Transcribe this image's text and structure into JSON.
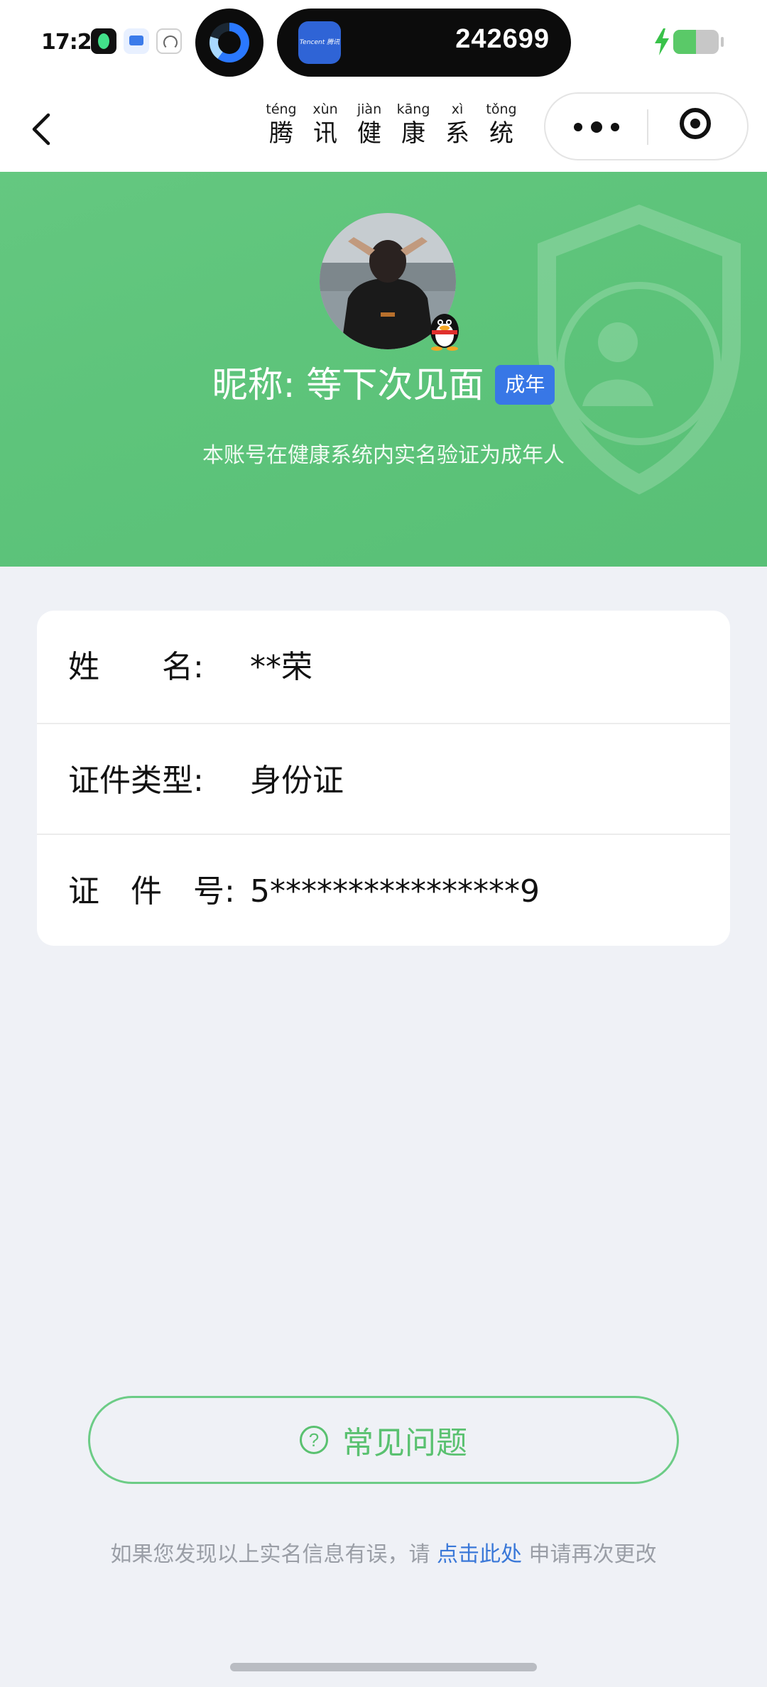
{
  "status_bar": {
    "time": "17:26",
    "island_app_label": "Tencent 腾讯",
    "island_code": "242699",
    "battery_level_fraction": 0.5
  },
  "nav": {
    "title_chars": [
      {
        "pinyin": "téng",
        "hanzi": "腾"
      },
      {
        "pinyin": "xùn",
        "hanzi": "讯"
      },
      {
        "pinyin": "jiàn",
        "hanzi": "健"
      },
      {
        "pinyin": "kāng",
        "hanzi": "康"
      },
      {
        "pinyin": "xì",
        "hanzi": "系"
      },
      {
        "pinyin": "tǒng",
        "hanzi": "统"
      }
    ]
  },
  "profile": {
    "nickname": "昵称: 等下次见面",
    "adult_tag": "成年",
    "description": "本账号在健康系统内实名验证为成年人"
  },
  "info": {
    "name_label": "姓　　名:",
    "name_value": "**荣",
    "id_type_label": "证件类型:",
    "id_type_value": "身份证",
    "id_number_label": "证　件　号:",
    "id_number_value": "5****************9"
  },
  "faq": {
    "icon_glyph": "?",
    "label": "常见问题"
  },
  "footer": {
    "prefix": "如果您发现以上实名信息有误，请 ",
    "link": "点击此处",
    "suffix": " 申请再次更改"
  },
  "colors": {
    "accent_green": "#5ac170",
    "tag_blue": "#3877e6",
    "link_blue": "#3a78d8"
  },
  "icons": [
    "back-arrow-icon",
    "more-icon",
    "close-miniapp-icon",
    "question-circle-icon",
    "qq-penguin-icon",
    "shield-icon",
    "charging-bolt-icon"
  ]
}
